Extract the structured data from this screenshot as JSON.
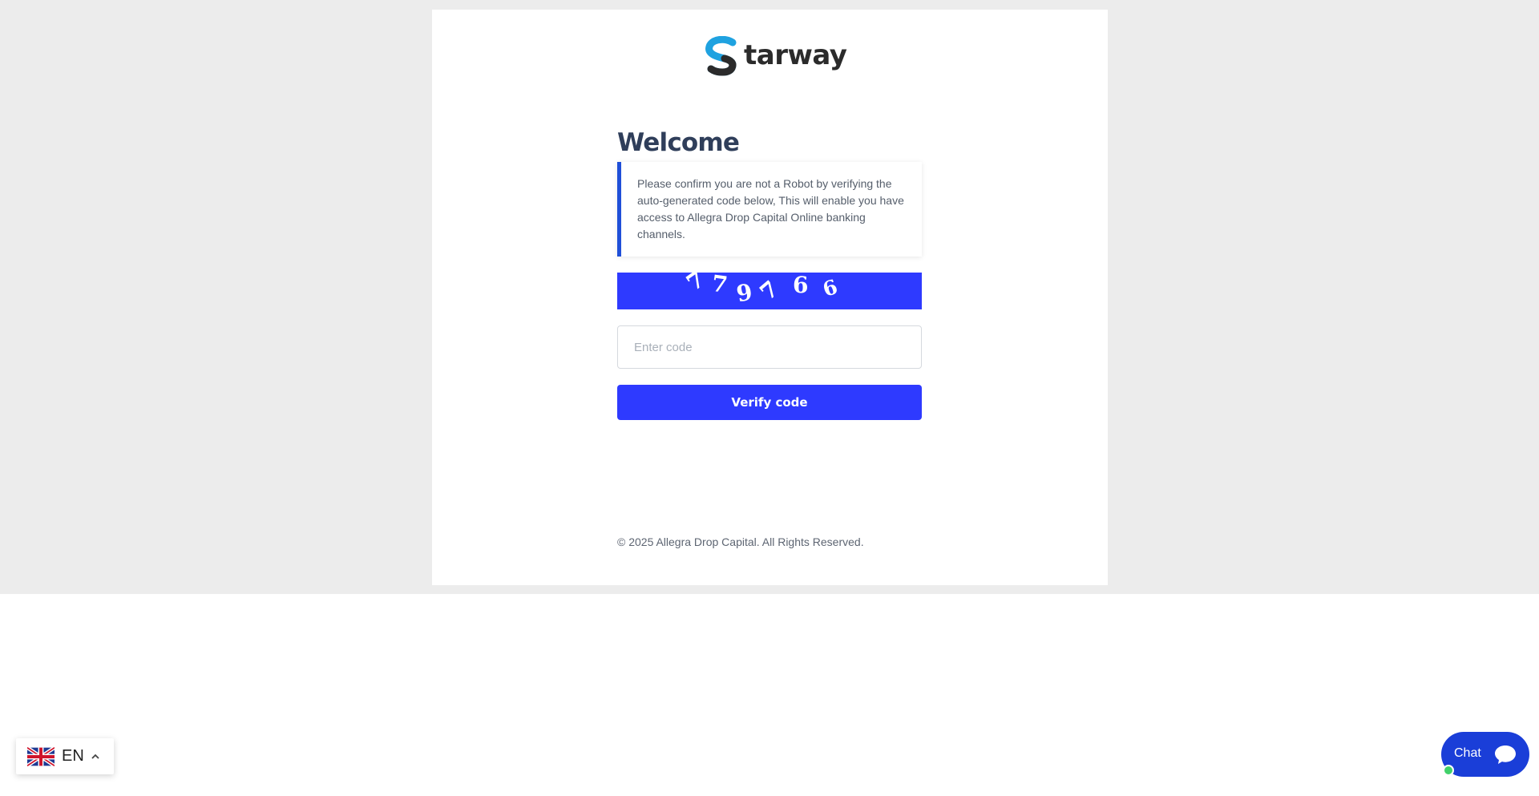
{
  "brand": {
    "logo_text": "tarway",
    "colors": {
      "blue": "#1fa2e0",
      "dark": "#2b2b2b"
    }
  },
  "welcome": {
    "title": "Welcome",
    "notice": "Please confirm you are not a Robot by verifying the auto-generated code below, This will enable you have access to Allegra Drop Capital Online banking channels."
  },
  "captcha": {
    "digits": [
      "7",
      "7",
      "9",
      "7",
      "6",
      "6"
    ],
    "background": "#2e3aff"
  },
  "form": {
    "code_placeholder": "Enter code",
    "code_value": "",
    "verify_label": "Verify code",
    "accent": "#2e3aff"
  },
  "footer": {
    "copyright": "© 2025 Allegra Drop Capital. All Rights Reserved."
  },
  "language": {
    "code": "EN",
    "flag_icon": "uk-flag-icon",
    "chevron": "chevron-up-icon"
  },
  "chat": {
    "label": "Chat",
    "icon": "chat-bubble-icon",
    "status": "online"
  }
}
